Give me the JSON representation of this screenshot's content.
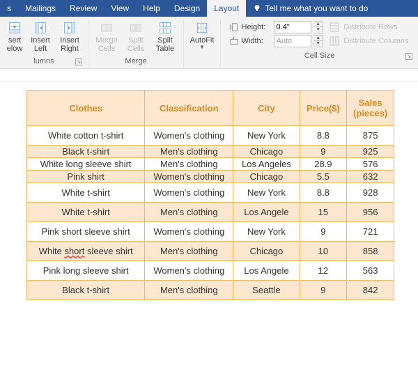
{
  "tabs": {
    "items": [
      "s",
      "Mailings",
      "Review",
      "View",
      "Help",
      "Design",
      "Layout"
    ],
    "active": "Layout",
    "tell_me": "Tell me what you want to do"
  },
  "ribbon": {
    "rows_cols": {
      "insert_below": "sert\nelow",
      "insert_left": "Insert\nLeft",
      "insert_right": "Insert\nRight",
      "label": "lumns"
    },
    "merge": {
      "merge_cells": "Merge\nCells",
      "split_cells": "Split\nCells",
      "split_table": "Split\nTable",
      "label": "Merge"
    },
    "autofit": {
      "label": "AutoFit"
    },
    "cell_size": {
      "height_label": "Height:",
      "height_value": "0.4\"",
      "width_label": "Width:",
      "width_value": "Auto",
      "dist_rows": "Distribute Rows",
      "dist_cols": "Distribute Columns",
      "label": "Cell Size"
    }
  },
  "table": {
    "headers": [
      "Clothes",
      "Classification",
      "City",
      "Price($)",
      "Sales\n(pieces)"
    ],
    "rows": [
      {
        "band": false,
        "short": false,
        "c": [
          "White cotton t-shirt",
          "Women's clothing",
          "New York",
          "8.8",
          "875"
        ]
      },
      {
        "band": true,
        "short": true,
        "c": [
          "Black t-shirt",
          "Men's clothing",
          "Chicago",
          "9",
          "925"
        ]
      },
      {
        "band": false,
        "short": true,
        "c": [
          "White long sleeve shirt",
          "Men's clothing",
          "Los Angeles",
          "28.9",
          "576"
        ]
      },
      {
        "band": true,
        "short": true,
        "c": [
          "Pink shirt",
          "Women's clothing",
          "Chicago",
          "5.5",
          "632"
        ]
      },
      {
        "band": false,
        "short": false,
        "c": [
          "White t-shirt",
          "Women's clothing",
          "New York",
          "8.8",
          "928"
        ]
      },
      {
        "band": true,
        "short": false,
        "c": [
          "White t-shirt",
          "Men's clothing",
          "Los Angele",
          "15",
          "956"
        ]
      },
      {
        "band": false,
        "short": false,
        "c": [
          "Pink short sleeve shirt",
          "Women's clothing",
          "New York",
          "9",
          "721"
        ]
      },
      {
        "band": true,
        "short": false,
        "c": [
          "White short sleeve shirt",
          "Men's clothing",
          "Chicago",
          "10",
          "858"
        ],
        "underline_word": "short"
      },
      {
        "band": false,
        "short": false,
        "c": [
          "Pink long sleeve shirt",
          "Women's clothing",
          "Los Angele",
          "12",
          "563"
        ]
      },
      {
        "band": true,
        "short": false,
        "c": [
          "Black t-shirt",
          "Men's clothing",
          "Seattle",
          "9",
          "842"
        ]
      }
    ]
  }
}
